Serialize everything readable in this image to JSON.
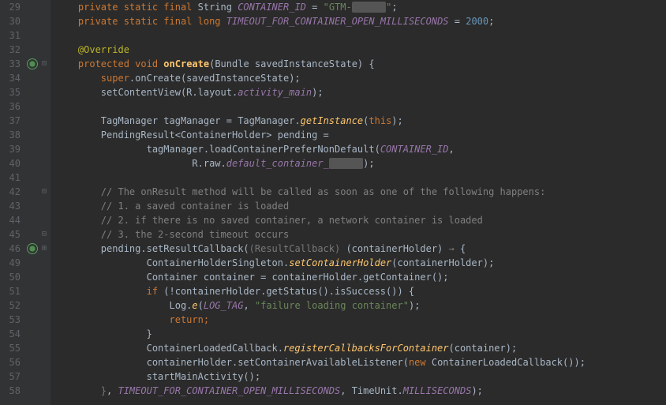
{
  "lines": [
    {
      "n": 29,
      "html": "    <span class='kw'>private static final</span> String <span class='field-it'>CONTAINER_ID</span> = <span class='str'>\"GTM-</span><span class='redact'>XXXXXX</span><span class='str'>\"</span>;"
    },
    {
      "n": 30,
      "html": "    <span class='kw'>private static final long</span> <span class='field-it'>TIMEOUT_FOR_CONTAINER_OPEN_MILLISECONDS</span> = <span class='num'>2000</span>;"
    },
    {
      "n": 31,
      "html": ""
    },
    {
      "n": 32,
      "html": "    <span class='ann'>@Override</span>"
    },
    {
      "n": 33,
      "html": "    <span class='kw'>protected void</span> <span class='decl'>onCreate</span>(Bundle savedInstanceState) {",
      "mark": "override",
      "fold": "-"
    },
    {
      "n": 34,
      "html": "        <span class='kw'>super</span>.onCreate(savedInstanceState);"
    },
    {
      "n": 35,
      "html": "        setContentView(R.layout.<span class='field-it'>activity_main</span>);"
    },
    {
      "n": 36,
      "html": ""
    },
    {
      "n": 37,
      "html": "        TagManager tagManager = TagManager.<span class='method-it'>getInstance</span>(<span class='kw'>this</span>);"
    },
    {
      "n": 38,
      "html": "        PendingResult&lt;ContainerHolder&gt; pending ="
    },
    {
      "n": 39,
      "html": "                tagManager.loadContainerPreferNonDefault(<span class='field-it'>CONTAINER_ID</span>,"
    },
    {
      "n": 40,
      "html": "                        R.raw.<span class='field-it'>default_container_</span><span class='redact'>xxxxxx</span>);"
    },
    {
      "n": 41,
      "html": ""
    },
    {
      "n": 42,
      "html": "        <span class='cmt'>// The onResult method will be called as soon as one of the following happens:</span>",
      "fold": "-"
    },
    {
      "n": 43,
      "html": "        <span class='cmt'>// 1. a saved container is loaded</span>"
    },
    {
      "n": 44,
      "html": "        <span class='cmt'>// 2. if there is no saved container, a network container is loaded</span>"
    },
    {
      "n": 45,
      "html": "        <span class='cmt'>// 3. the 2-second timeout occurs</span>",
      "fold": "-"
    },
    {
      "n": 46,
      "html": "        pending.setResultCallback(<span class='hint'>(ResultCallback)</span> (containerHolder) <span class='hint'>&rarr;</span> {",
      "mark": "override",
      "fold": "+"
    },
    {
      "n": 49,
      "html": "                ContainerHolderSingleton.<span class='method-it'>setContainerHolder</span>(containerHolder);"
    },
    {
      "n": 50,
      "html": "                Container container = containerHolder.getContainer();"
    },
    {
      "n": 51,
      "html": "                <span class='kw'>if</span> (!containerHolder.getStatus().isSuccess()) {"
    },
    {
      "n": 52,
      "html": "                    Log.<span class='method-it'>e</span>(<span class='field-it'>LOG_TAG</span>, <span class='str'>\"failure loading container\"</span>);"
    },
    {
      "n": 53,
      "html": "                    <span class='kw'>return;</span>"
    },
    {
      "n": 54,
      "html": "                }"
    },
    {
      "n": 55,
      "html": "                ContainerLoadedCallback.<span class='method-it'>registerCallbacksForContainer</span>(container);"
    },
    {
      "n": 56,
      "html": "                containerHolder.setContainerAvailableListener(<span class='kw'>new</span> ContainerLoadedCallback());"
    },
    {
      "n": 57,
      "html": "                startMainActivity();"
    },
    {
      "n": 58,
      "html": "        <span class='hint'>}</span>, <span class='field-it'>TIMEOUT_FOR_CONTAINER_OPEN_MILLISECONDS</span>, TimeUnit.<span class='field-it'>MILLISECONDS</span>);"
    }
  ]
}
